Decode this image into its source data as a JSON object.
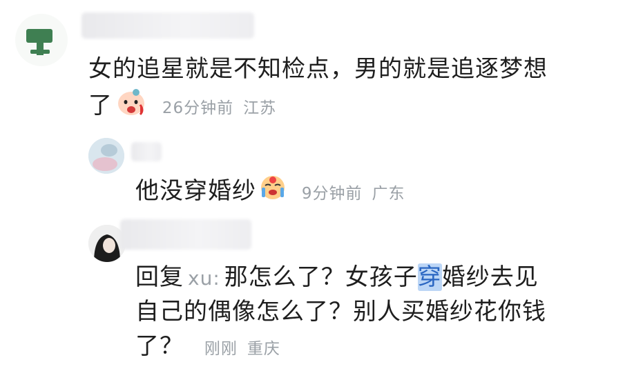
{
  "comments": [
    {
      "text_line1": "女的追星就是不知检点，男的就是追逐梦想",
      "text_line2": "了",
      "time": "26分钟前",
      "location": "江苏",
      "emoji": "crying-face-icon"
    },
    {
      "text": "他没穿婚纱",
      "time": "9分钟前",
      "location": "广东",
      "emoji": "loudly-crying-face-icon"
    },
    {
      "reply_label": "回复",
      "reply_to": "xu:",
      "text_line1_a": "那怎么了？女孩子",
      "text_line1_highlight": "穿",
      "text_line1_b": "婚纱去见",
      "text_line2": "自己的偶像怎么了？别人买婚纱花你钱",
      "text_line3": "了？",
      "time": "刚刚",
      "location": "重庆"
    }
  ]
}
